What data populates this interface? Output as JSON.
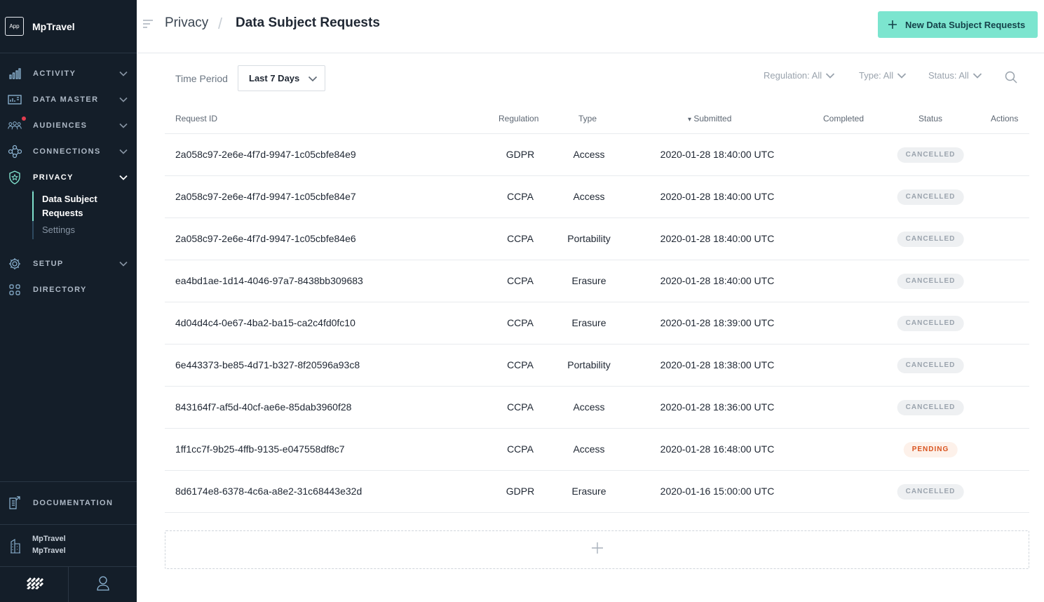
{
  "brand": {
    "logo_text": "App",
    "name": "MpTravel"
  },
  "nav": {
    "items": [
      {
        "label": "ACTIVITY",
        "icon": "bar-chart-icon"
      },
      {
        "label": "DATA MASTER",
        "icon": "data-master-icon"
      },
      {
        "label": "AUDIENCES",
        "icon": "people-icon",
        "notification": true
      },
      {
        "label": "CONNECTIONS",
        "icon": "connections-icon"
      },
      {
        "label": "PRIVACY",
        "icon": "shield-icon",
        "expanded": true
      },
      {
        "label": "SETUP",
        "icon": "gear-icon"
      },
      {
        "label": "DIRECTORY",
        "icon": "grid-icon"
      }
    ],
    "privacy_sub": {
      "active": "Data Subject Requests",
      "other": "Settings"
    }
  },
  "sidebar_bottom": {
    "documentation": "DOCUMENTATION",
    "account_line1": "MpTravel",
    "account_line2": "MpTravel"
  },
  "header": {
    "breadcrumb_parent": "Privacy",
    "breadcrumb_sep": "/",
    "title": "Data Subject Requests",
    "new_button": "New Data Subject Requests"
  },
  "filters": {
    "time_period_label": "Time Period",
    "time_period_value": "Last 7 Days",
    "regulation": "Regulation: All",
    "type": "Type: All",
    "status": "Status: All"
  },
  "table": {
    "columns": {
      "request_id": "Request ID",
      "regulation": "Regulation",
      "type": "Type",
      "submitted": "Submitted",
      "sort_indicator": "▾",
      "completed": "Completed",
      "status": "Status",
      "actions": "Actions"
    },
    "rows": [
      {
        "id": "2a058c97-2e6e-4f7d-9947-1c05cbfe84e9",
        "regulation": "GDPR",
        "type": "Access",
        "submitted": "2020-01-28 18:40:00 UTC",
        "completed": "",
        "status": "CANCELLED"
      },
      {
        "id": "2a058c97-2e6e-4f7d-9947-1c05cbfe84e7",
        "regulation": "CCPA",
        "type": "Access",
        "submitted": "2020-01-28 18:40:00 UTC",
        "completed": "",
        "status": "CANCELLED"
      },
      {
        "id": "2a058c97-2e6e-4f7d-9947-1c05cbfe84e6",
        "regulation": "CCPA",
        "type": "Portability",
        "submitted": "2020-01-28 18:40:00 UTC",
        "completed": "",
        "status": "CANCELLED"
      },
      {
        "id": "ea4bd1ae-1d14-4046-97a7-8438bb309683",
        "regulation": "CCPA",
        "type": "Erasure",
        "submitted": "2020-01-28 18:40:00 UTC",
        "completed": "",
        "status": "CANCELLED"
      },
      {
        "id": "4d04d4c4-0e67-4ba2-ba15-ca2c4fd0fc10",
        "regulation": "CCPA",
        "type": "Erasure",
        "submitted": "2020-01-28 18:39:00 UTC",
        "completed": "",
        "status": "CANCELLED"
      },
      {
        "id": "6e443373-be85-4d71-b327-8f20596a93c8",
        "regulation": "CCPA",
        "type": "Portability",
        "submitted": "2020-01-28 18:38:00 UTC",
        "completed": "",
        "status": "CANCELLED"
      },
      {
        "id": "843164f7-af5d-40cf-ae6e-85dab3960f28",
        "regulation": "CCPA",
        "type": "Access",
        "submitted": "2020-01-28 18:36:00 UTC",
        "completed": "",
        "status": "CANCELLED"
      },
      {
        "id": "1ff1cc7f-9b25-4ffb-9135-e047558df8c7",
        "regulation": "CCPA",
        "type": "Access",
        "submitted": "2020-01-28 16:48:00 UTC",
        "completed": "",
        "status": "PENDING"
      },
      {
        "id": "8d6174e8-6378-4c6a-a8e2-31c68443e32d",
        "regulation": "GDPR",
        "type": "Erasure",
        "submitted": "2020-01-16 15:00:00 UTC",
        "completed": "",
        "status": "CANCELLED"
      }
    ]
  },
  "colors": {
    "sidebar_bg": "#141e29",
    "accent": "#7ce5cf",
    "cancelled_badge": "#9aa3ad",
    "pending_badge": "#d9531e",
    "notification_dot": "#e23d4f"
  }
}
